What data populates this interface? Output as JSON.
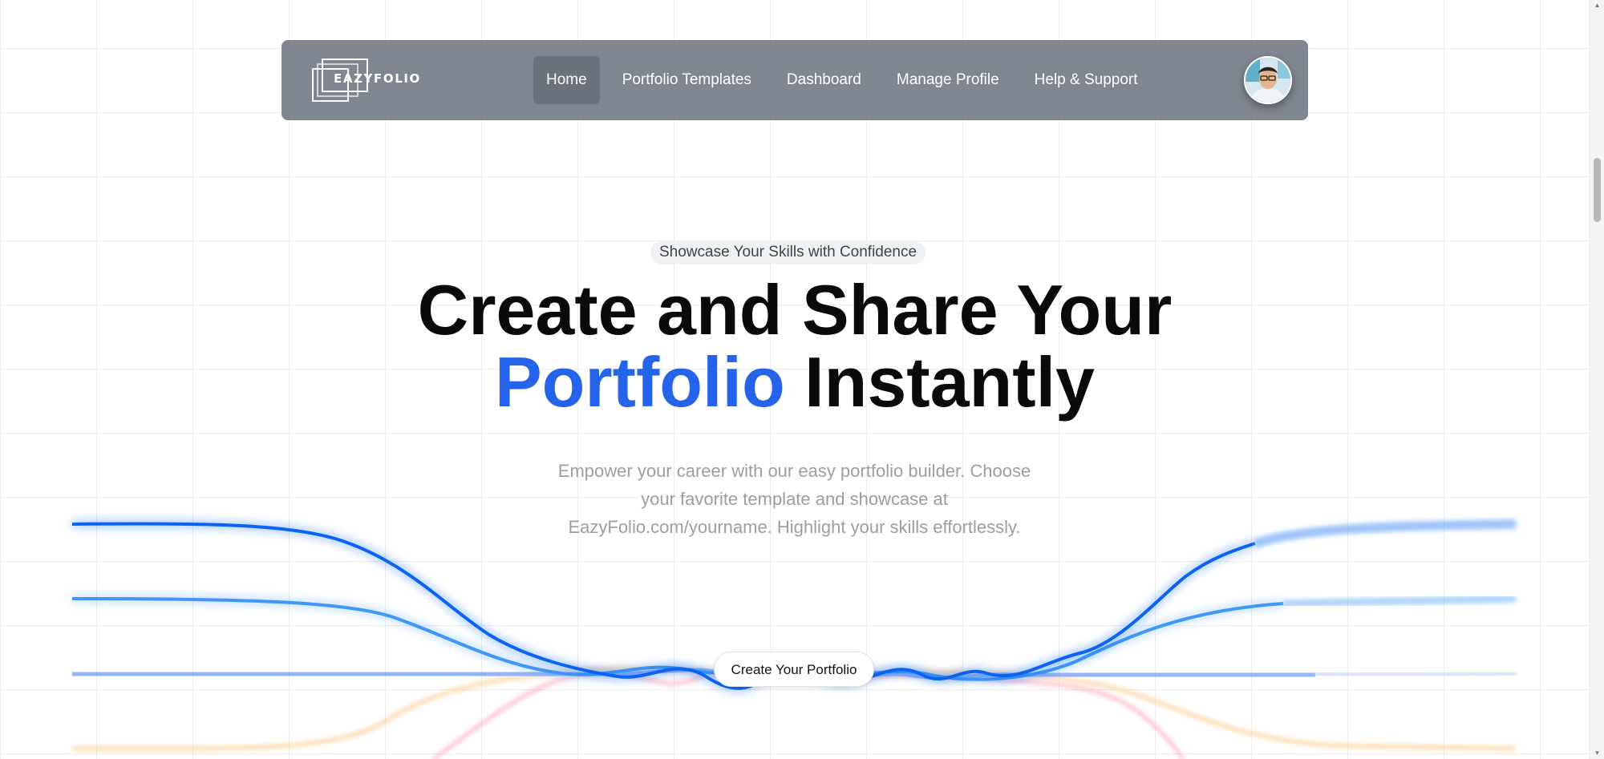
{
  "navbar": {
    "logo_text": "EAZYFOLIO",
    "links": [
      {
        "label": "Home",
        "active": true
      },
      {
        "label": "Portfolio Templates",
        "active": false
      },
      {
        "label": "Dashboard",
        "active": false
      },
      {
        "label": "Manage Profile",
        "active": false
      },
      {
        "label": "Help & Support",
        "active": false
      }
    ],
    "avatar_icon": "user-avatar-photo"
  },
  "hero": {
    "badge": "Showcase Your Skills with Confidence",
    "headline_line1": "Create and Share Your",
    "headline_accent": "Portfolio",
    "headline_rest": " Instantly",
    "subtext": "Empower your career with our easy portfolio builder. Choose your favorite template and showcase at EazyFolio.com/yourname. Highlight your skills effortlessly.",
    "cta_label": "Create Your Portfolio"
  },
  "colors": {
    "navbar_bg": "#80868f",
    "accent_blue": "#2563eb",
    "wave_blue_dark": "#0a63f2",
    "wave_blue_mid": "#3f97f7",
    "wave_blue_light": "#8fb0fb",
    "wave_orange": "#ffd3a0",
    "wave_pink": "#ffaab8"
  },
  "scrollbar": {
    "up_icon": "scroll-up-arrow-icon",
    "down_icon": "scroll-down-arrow-icon"
  }
}
